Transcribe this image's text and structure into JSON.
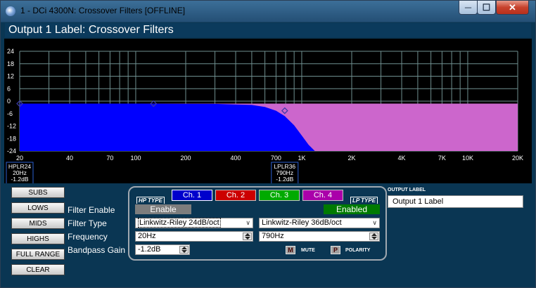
{
  "window": {
    "title": "1 - DCi 4300N: Crossover Filters [OFFLINE]",
    "min_glyph": "─",
    "max_glyph": "☐",
    "close_glyph": "✕"
  },
  "header": {
    "title": "Output 1 Label: Crossover Filters"
  },
  "chart_data": {
    "type": "area",
    "title": "",
    "xlabel": "",
    "ylabel": "",
    "x_scale": "log",
    "xlim": [
      20,
      20000
    ],
    "ylim": [
      -24,
      24
    ],
    "grid": true,
    "x_tick_labels": [
      "20",
      "40",
      "70",
      "100",
      "200",
      "400",
      "700",
      "1K",
      "2K",
      "4K",
      "7K",
      "10K",
      "20K"
    ],
    "x_tick_values": [
      20,
      40,
      70,
      100,
      200,
      400,
      700,
      1000,
      2000,
      4000,
      7000,
      10000,
      20000
    ],
    "y_tick_labels": [
      "24",
      "18",
      "12",
      "6",
      "0",
      "-6",
      "-12",
      "-18",
      "-24"
    ],
    "y_tick_values": [
      24,
      18,
      12,
      6,
      0,
      -6,
      -12,
      -18,
      -24
    ],
    "colors": {
      "hp_fill": "#0000ff",
      "lp_fill": "#cc66cc",
      "grid": "#6f8f8f",
      "axis_text": "#ffffff"
    },
    "series": [
      {
        "curve": "lp",
        "type": "Linkwitz-Riley 36dB/oct",
        "frequency_hz": 790,
        "gain_db": -1.2,
        "x": [
          20,
          100,
          300,
          500,
          600,
          700,
          790,
          900,
          1000,
          1100,
          1200,
          20000
        ],
        "y": [
          -1.2,
          -1.2,
          -1.3,
          -1.8,
          -2.8,
          -4.6,
          -7.2,
          -11.6,
          -16.5,
          -21.0,
          -24,
          -24
        ]
      },
      {
        "curve": "hp",
        "type": "Linkwitz-Riley 24dB/oct",
        "frequency_hz": 20,
        "gain_db": -1.2,
        "x": [
          20,
          30,
          50,
          100,
          1000,
          20000
        ],
        "y": [
          -2.8,
          -1.4,
          -1.2,
          -1.2,
          -1.2,
          -1.2
        ]
      }
    ],
    "markers": [
      {
        "x": 20,
        "y": -1.2
      },
      {
        "x": 128,
        "y": -1.2
      },
      {
        "x": 790,
        "y": -4.6
      }
    ],
    "annotations": [
      {
        "lines": [
          "HPLR24",
          "20Hz",
          "-1.2dB"
        ],
        "x": 20
      },
      {
        "lines": [
          "LPLR36",
          "790Hz",
          "-1.2dB"
        ],
        "x": 790
      }
    ]
  },
  "sidebar": {
    "buttons": [
      "SUBS",
      "LOWS",
      "MIDS",
      "HIGHS",
      "FULL RANGE",
      "CLEAR"
    ]
  },
  "rows": {
    "filter_enable": "Filter Enable",
    "filter_type": "Filter Type",
    "frequency": "Frequency",
    "bandpass_gain": "Bandpass Gain"
  },
  "channels": [
    {
      "label": "Ch. 1",
      "color": "#0000cc",
      "selected": true
    },
    {
      "label": "Ch. 2",
      "color": "#cc0000",
      "selected": false
    },
    {
      "label": "Ch. 3",
      "color": "#00aa00",
      "selected": false
    },
    {
      "label": "Ch. 4",
      "color": "#aa00aa",
      "selected": false
    }
  ],
  "hp": {
    "tab_label": "HP TYPE",
    "enable_label": "Enable",
    "enabled": false,
    "filter_type": "Linkwitz-Riley 24dB/oct",
    "frequency": "20Hz"
  },
  "lp": {
    "tab_label": "LP TYPE",
    "enable_label": "Enabled",
    "enabled": true,
    "filter_type": "Linkwitz-Riley 36dB/oct",
    "frequency": "790Hz"
  },
  "gain": {
    "value": "-1.2dB"
  },
  "mute": {
    "icon": "M",
    "label": "MUTE"
  },
  "polarity": {
    "icon": "P",
    "label": "POLARITY"
  },
  "output_label": {
    "title": "OUTPUT LABEL",
    "value": "Output 1 Label"
  }
}
